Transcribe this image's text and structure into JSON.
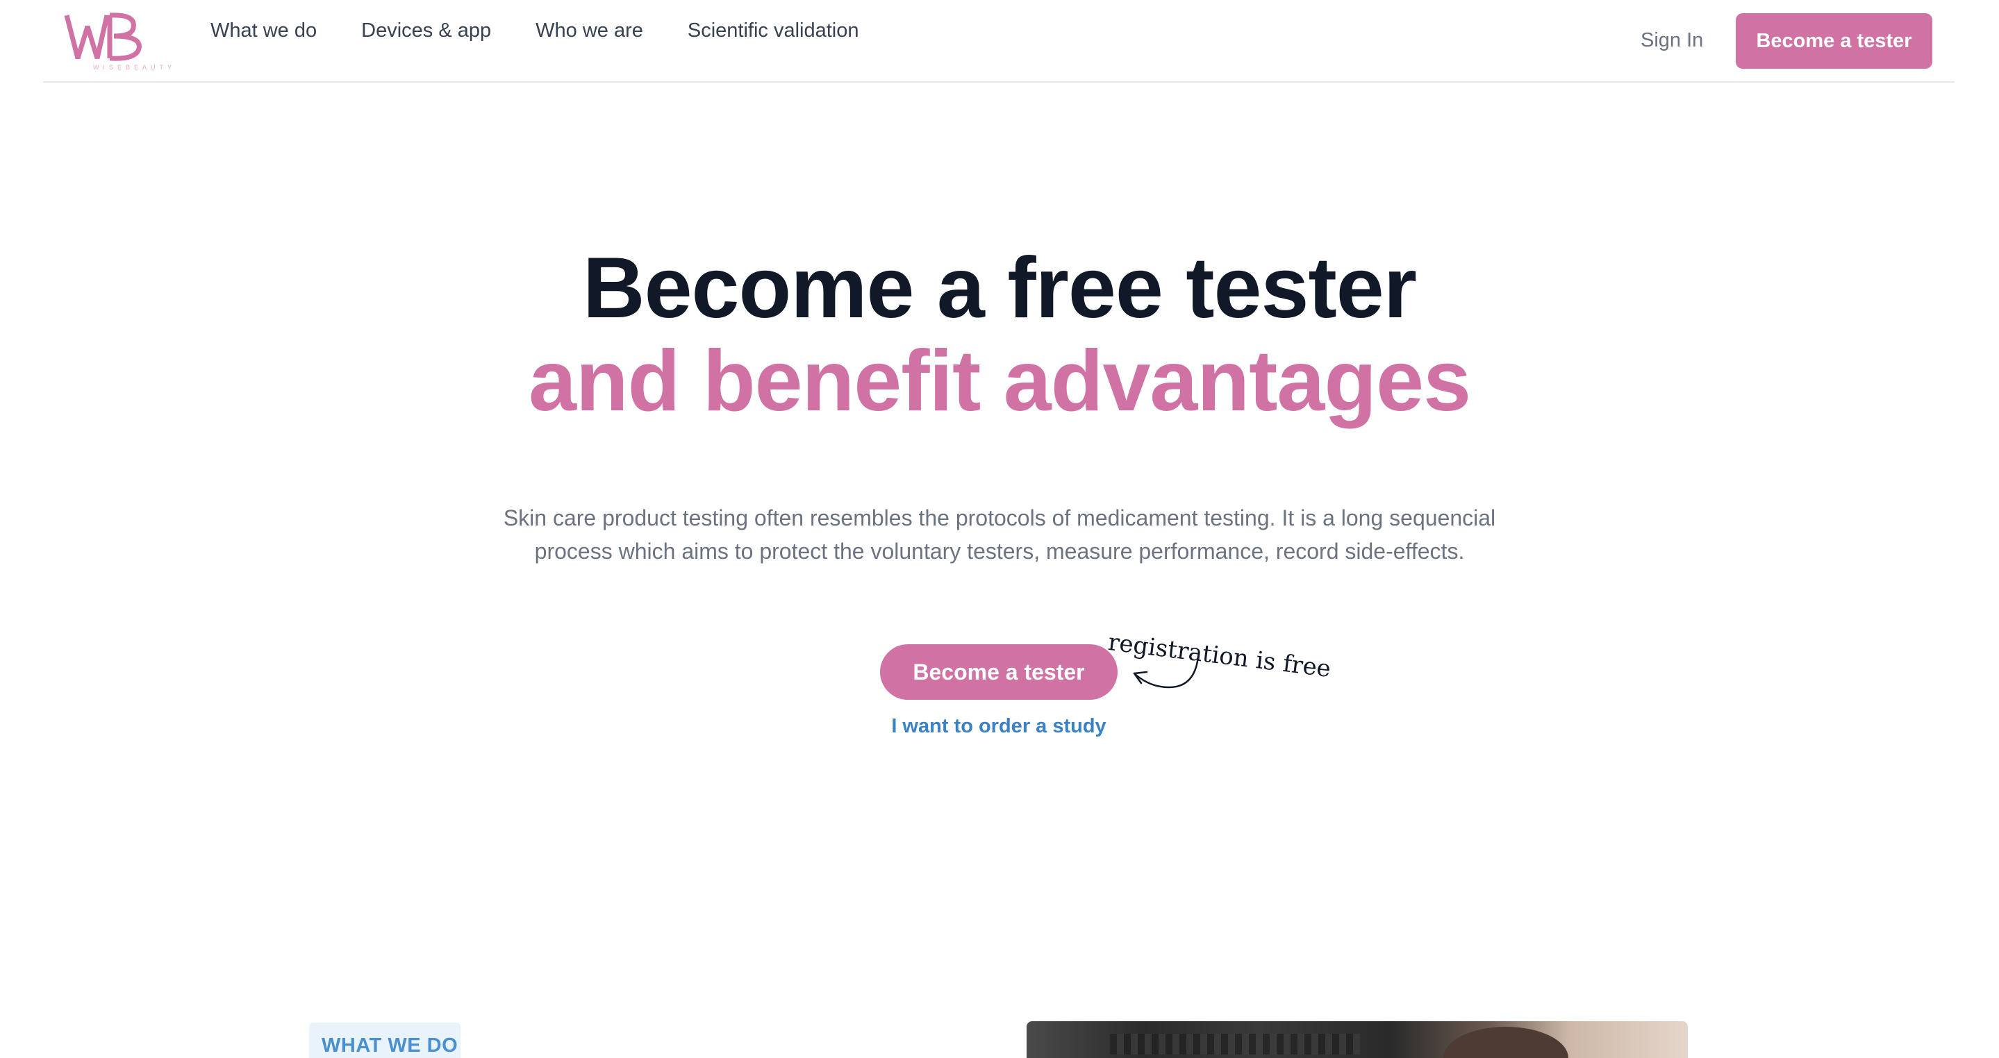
{
  "header": {
    "logo_text": "WB",
    "logo_subtext": "WISEBEAUTY",
    "nav": [
      {
        "label": "What we do"
      },
      {
        "label": "Devices & app"
      },
      {
        "label": "Who we are"
      },
      {
        "label": "Scientific validation"
      }
    ],
    "sign_in_label": "Sign In",
    "cta_label": "Become a tester"
  },
  "hero": {
    "title_line1": "Become a free tester",
    "title_line2": "and benefit advantages",
    "description": "Skin care product testing often resembles the protocols of medicament testing. It is a long sequencial process which aims to protect the voluntary testers, measure performance, record side-effects.",
    "cta_label": "Become a tester",
    "order_link_label": "I want to order a study",
    "free_note": "registration is free"
  },
  "section": {
    "badge_label": "WHAT WE DO"
  },
  "colors": {
    "brand_pink": "#d072a4",
    "link_blue": "#3b82c4",
    "heading_dark": "#111827",
    "badge_bg": "#e8f3fc"
  },
  "icons": {
    "logo": "wb-monogram-logo",
    "free_arrow": "curved-arrow-icon"
  }
}
